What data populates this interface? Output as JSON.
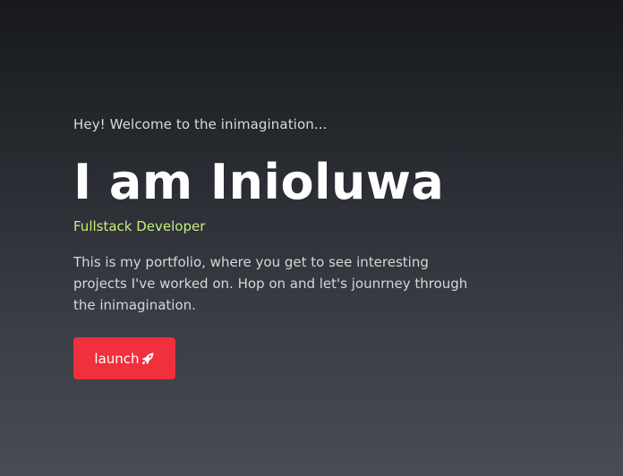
{
  "hero": {
    "greeting": "Hey! Welcome to the inimagination...",
    "name": "I am Inioluwa",
    "role": "Fullstack Developer",
    "bio": "This is my portfolio, where you get to see interesting projects I've worked on. Hop on and let's jounrney through the inimagination.",
    "cta": {
      "label": "launch",
      "icon": "rocket-icon"
    }
  },
  "colors": {
    "accent": "#f0303d",
    "role": "#c7ee7b",
    "background_top": "#17191d",
    "background_bottom": "#494c54"
  }
}
